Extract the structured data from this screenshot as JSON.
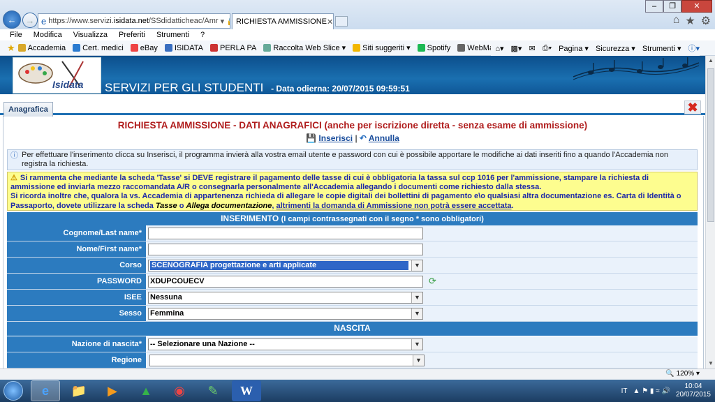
{
  "browser": {
    "url_prefix": "https://www.servizi.",
    "url_domain": "isidata.net",
    "url_rest": "/SSdidatticheac/Amr",
    "tab_title": "RICHIESTA AMMISSIONE",
    "menu": [
      "File",
      "Modifica",
      "Visualizza",
      "Preferiti",
      "Strumenti",
      "?"
    ],
    "favorites": [
      "Accademia",
      "Cert. medici",
      "eBay",
      "ISIDATA",
      "PERLA PA",
      "Raccolta Web Slice ▾",
      "Siti suggeriti ▾",
      "Spotify",
      "WebMail"
    ],
    "favorite_colors": [
      "#d8a82a",
      "#2a7bd0",
      "#e44",
      "#3a6fc0",
      "#c33",
      "#6a9",
      "#f2b700",
      "#1db954",
      "#666"
    ],
    "commands": [
      "Pagina ▾",
      "Sicurezza ▾",
      "Strumenti ▾"
    ],
    "zoom": "120%"
  },
  "site": {
    "logo_text": "Isidata",
    "title": "SERVIZI PER GLI STUDENTI",
    "date": "- Data odierna: 20/07/2015 09:59:51",
    "tab_label": "Anagrafica"
  },
  "form": {
    "title": "RICHIESTA AMMISSIONE - DATI ANAGRAFICI (anche per iscrizione diretta - senza esame di ammissione)",
    "insert_label": "Inserisci",
    "separator": "|",
    "cancel_label": "Annulla",
    "info": "Per effettuare l'inserimento clicca su Inserisci, il programma invierà alla vostra email utente e password con cui è possibile apportare le modifiche ai dati inseriti fino a quando l'Accademia non registra la richiesta.",
    "warning_1": "Si rammenta che mediante la scheda 'Tasse' si DEVE registrare il pagamento delle tasse di cui è obbligatoria la tassa sul ccp 1016 per l'ammissione, stampare la richiesta di ammissione ed inviarla mezzo raccomandata A/R o consegnarla personalmente all'Accademia allegando i documenti come richiesto dalla stessa.",
    "warning_2": "Si ricorda inoltre che, qualora la vs. Accademia di appartenenza richieda di allegare le copie digitali dei bollettini di pagamento e\\o qualsiasi altra documentazione es. Carta di Identità o Passaporto, dovete utilizzare la scheda",
    "warning_tasse": "Tasse",
    "warning_o": "o",
    "warning_allega": "Allega documentazione",
    "warning_link": "altrimenti la domanda di Ammissione non potrà essere accettata",
    "section_insert": "INSERIMENTO",
    "section_insert_note": "(I campi contrassegnati con il segno * sono obbligatori)",
    "label_cognome": "Cognome/Last name*",
    "label_nome": "Nome/First name*",
    "label_corso": "Corso",
    "value_corso": "SCENOGRAFIA progettazione e arti applicate",
    "label_password": "PASSWORD",
    "value_password": "XDUPCOUECV",
    "label_isee": "ISEE",
    "value_isee": "Nessuna",
    "label_sesso": "Sesso",
    "value_sesso": "Femmina",
    "section_nascita": "NASCITA",
    "label_nazione": "Nazione di nascita*",
    "value_nazione": "-- Selezionare una Nazione --",
    "label_regione": "Regione",
    "value_regione": ""
  },
  "taskbar": {
    "lang": "IT",
    "time": "10:04",
    "date": "20/07/2015"
  }
}
